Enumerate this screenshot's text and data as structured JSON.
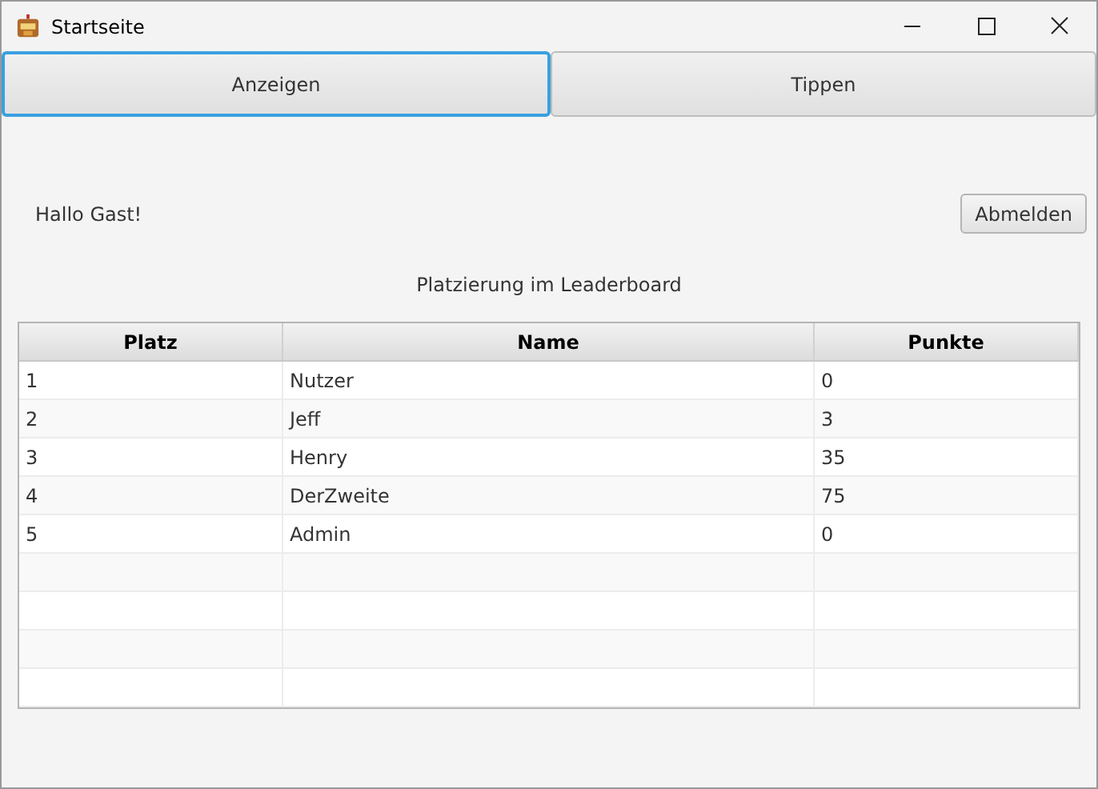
{
  "window": {
    "title": "Startseite"
  },
  "tabs": [
    {
      "label": "Anzeigen",
      "selected": true
    },
    {
      "label": "Tippen",
      "selected": false
    }
  ],
  "greeting": "Hallo Gast!",
  "logout_button": "Abmelden",
  "table": {
    "title": "Platzierung im Leaderboard",
    "columns": [
      "Platz",
      "Name",
      "Punkte"
    ],
    "rows": [
      [
        "1",
        "Nutzer",
        "0"
      ],
      [
        "2",
        "Jeff",
        "3"
      ],
      [
        "3",
        "Henry",
        "35"
      ],
      [
        "4",
        "DerZweite",
        "75"
      ],
      [
        "5",
        "Admin",
        "0"
      ]
    ]
  }
}
